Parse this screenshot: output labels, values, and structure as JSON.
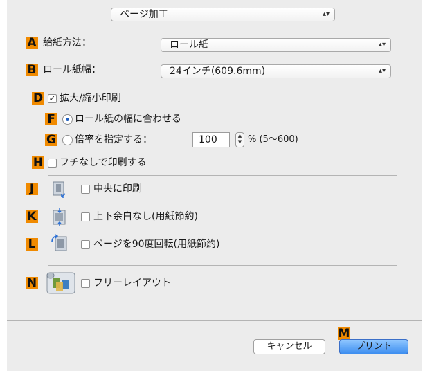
{
  "top_popup": {
    "label": "ページ加工"
  },
  "feed": {
    "badge": "A",
    "label": "給紙方法：",
    "value": "ロール紙"
  },
  "roll_width": {
    "badge": "B",
    "label": "ロール紙幅：",
    "value": "24インチ(609.6mm)"
  },
  "enlarge": {
    "badge": "D",
    "label": "拡大/縮小印刷",
    "checked": true
  },
  "fit_roll": {
    "badge": "F",
    "label": "ロール紙の幅に合わせる",
    "selected": true
  },
  "scale": {
    "badge": "G",
    "label": "倍率を指定する：",
    "value": "100",
    "range": "% (5〜600)"
  },
  "borderless": {
    "badge": "H",
    "label": "フチなしで印刷する"
  },
  "center": {
    "badge": "J",
    "label": "中央に印刷",
    "icon": "center-print-icon"
  },
  "no_margin": {
    "badge": "K",
    "label": "上下余白なし(用紙節約)",
    "icon": "no-margin-icon"
  },
  "rotate": {
    "badge": "L",
    "label": "ページを90度回転(用紙節約)",
    "icon": "rotate-page-icon"
  },
  "free_layout": {
    "badge": "N",
    "label": "フリーレイアウト",
    "icon": "free-layout-icon"
  },
  "print_badge": "M",
  "buttons": {
    "cancel": "キャンセル",
    "print": "プリント"
  },
  "colors": {
    "badge": "#f08a00",
    "accent": "#3d8ef0",
    "panel": "#ececec"
  }
}
